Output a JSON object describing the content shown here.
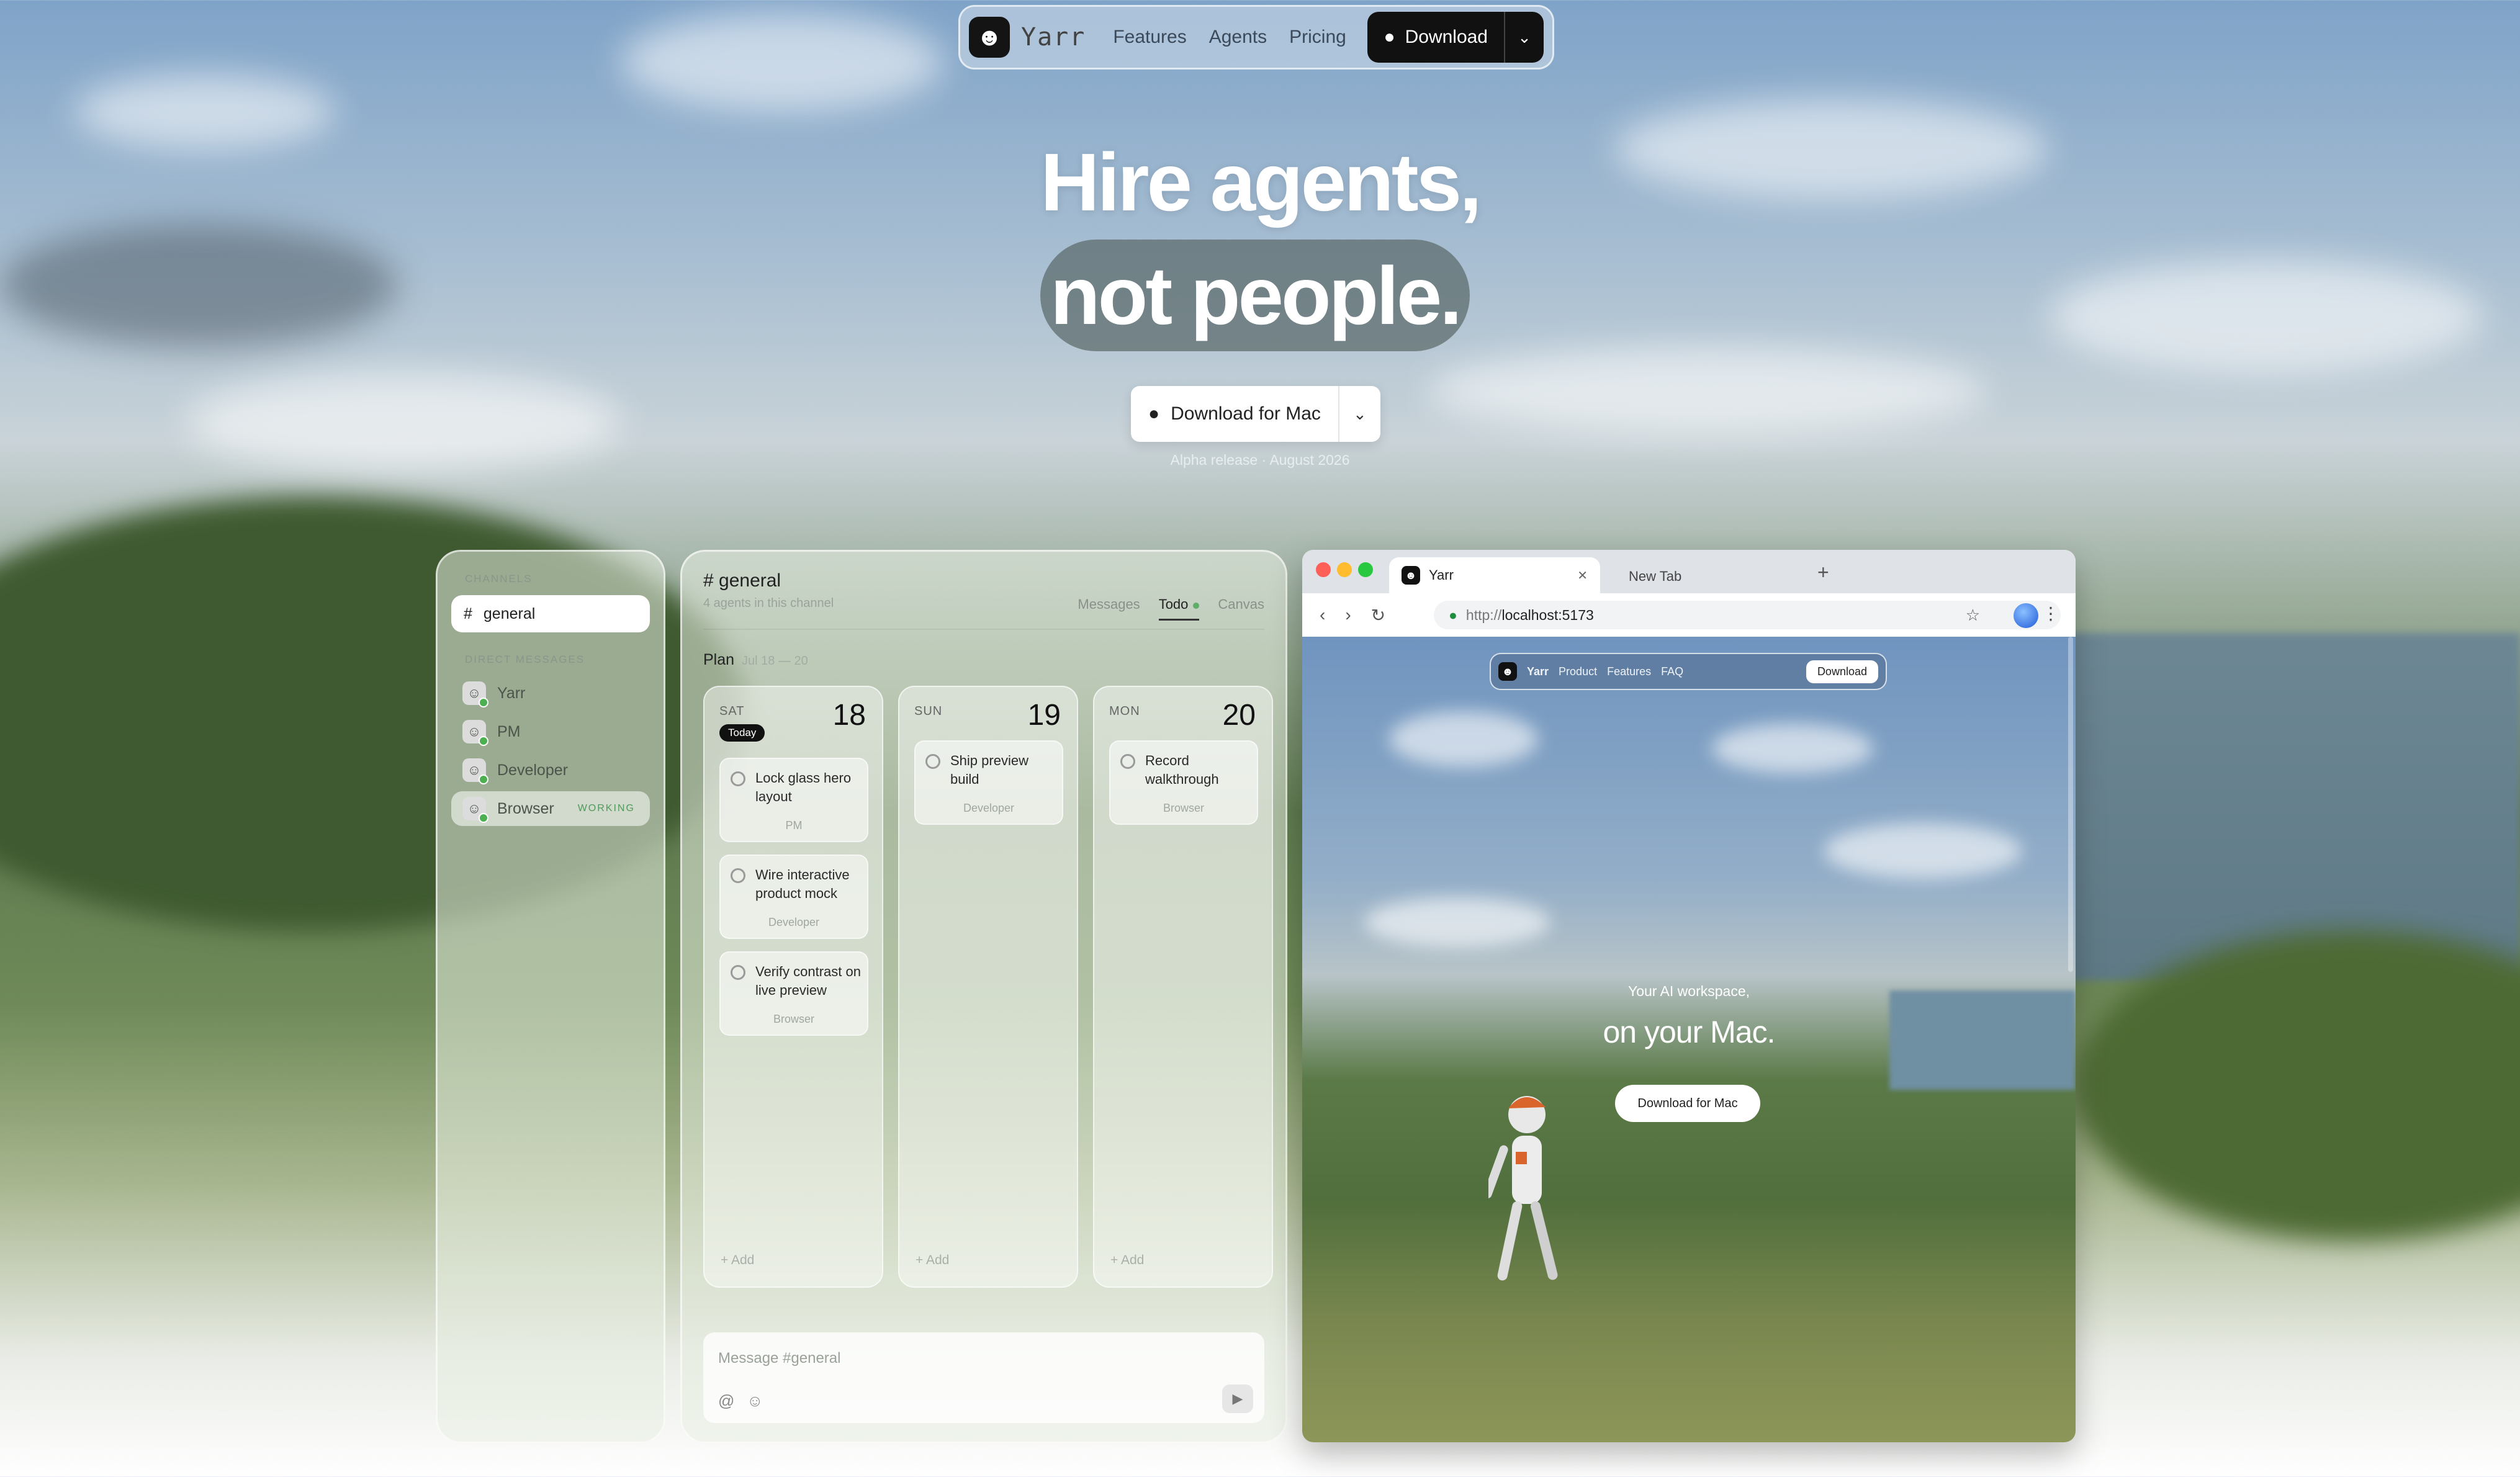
{
  "nav": {
    "brand": "Yarr",
    "links": [
      "Features",
      "Agents",
      "Pricing"
    ],
    "download_label": "Download"
  },
  "hero": {
    "line1": "Hire agents,",
    "line2": "not people.",
    "cta_label": "Download for Mac",
    "release_note": "Alpha release · August 2026"
  },
  "sidebar": {
    "channels_heading": "CHANNELS",
    "channel": "general",
    "dm_heading": "DIRECT MESSAGES",
    "dms": [
      {
        "name": "Yarr"
      },
      {
        "name": "PM"
      },
      {
        "name": "Developer"
      },
      {
        "name": "Browser",
        "status": "WORKING"
      }
    ]
  },
  "channel": {
    "title": "# general",
    "subtitle": "4 agents in this channel",
    "tabs": [
      "Messages",
      "Todo",
      "Canvas"
    ],
    "active_tab": "Todo",
    "plan_label": "Plan",
    "plan_range": "Jul 18 — 20",
    "today_badge": "Today",
    "add_label": "+ Add",
    "columns": [
      {
        "day": "SAT",
        "num": "18",
        "tasks": [
          {
            "text": "Lock glass hero layout",
            "assignee": "PM"
          },
          {
            "text": "Wire interactive product mock",
            "assignee": "Developer"
          },
          {
            "text": "Verify contrast on live preview",
            "assignee": "Browser"
          }
        ]
      },
      {
        "day": "SUN",
        "num": "19",
        "tasks": [
          {
            "text": "Ship preview build",
            "assignee": "Developer"
          }
        ]
      },
      {
        "day": "MON",
        "num": "20",
        "tasks": [
          {
            "text": "Record walkthrough",
            "assignee": "Browser"
          }
        ]
      }
    ],
    "message_placeholder": "Message #general"
  },
  "browser": {
    "tab1": "Yarr",
    "tab2": "New Tab",
    "url_proto": "http://",
    "url_host": "localhost:5173",
    "inner_nav": {
      "brand": "Yarr",
      "links": [
        "Product",
        "Features",
        "FAQ"
      ],
      "download": "Download"
    },
    "tagline": "Your AI workspace,",
    "headline": "on your Mac.",
    "cta": "Download for Mac"
  }
}
